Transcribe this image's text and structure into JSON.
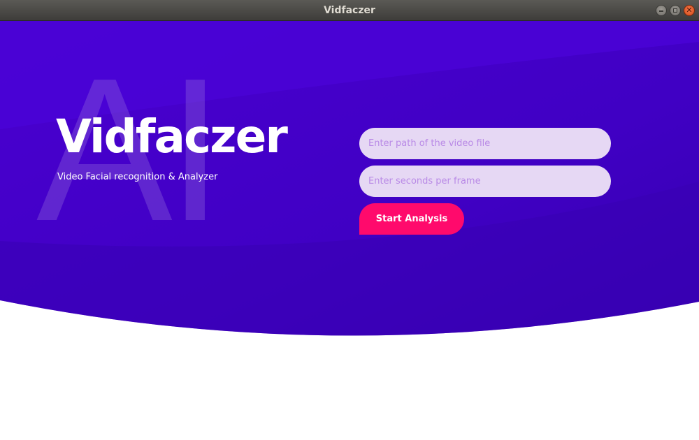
{
  "window": {
    "title": "Vidfaczer"
  },
  "hero": {
    "watermark": "AI",
    "title": "Vidfaczer",
    "subtitle": "Video Facial recognition & Analyzer"
  },
  "form": {
    "video_path_placeholder": "Enter path of the video file",
    "seconds_per_frame_placeholder": "Enter seconds per frame",
    "start_label": "Start Analysis"
  },
  "colors": {
    "hero_primary": "#4100c8",
    "hero_dark": "#3a00b4",
    "input_bg": "#e6d8f4",
    "input_placeholder": "#b98ae6",
    "button_accent": "#ff0a6c"
  },
  "icons": {
    "minimize": "minimize-icon",
    "maximize": "maximize-icon",
    "close": "close-icon"
  }
}
